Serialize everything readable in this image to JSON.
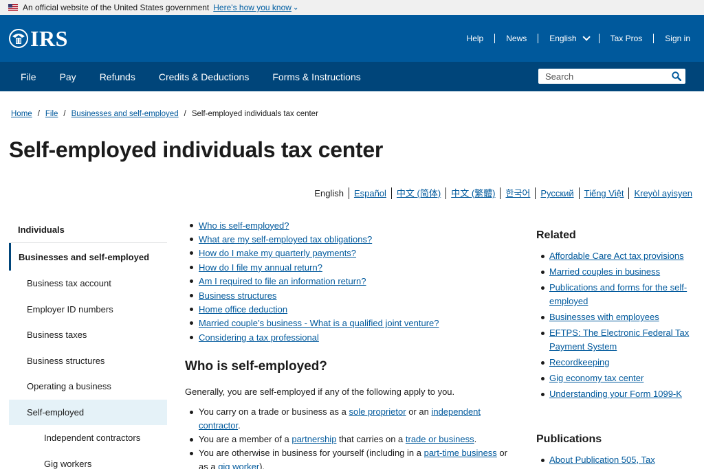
{
  "gov_banner": {
    "text": "An official website of the United States government",
    "link": "Here's how you know"
  },
  "header": {
    "logo": "IRS",
    "utility": [
      "Help",
      "News",
      "English",
      "Tax Pros",
      "Sign in"
    ]
  },
  "nav": {
    "items": [
      "File",
      "Pay",
      "Refunds",
      "Credits & Deductions",
      "Forms & Instructions"
    ],
    "search_placeholder": "Search"
  },
  "breadcrumb": [
    "Home",
    "File",
    "Businesses and self-employed",
    "Self-employed individuals tax center"
  ],
  "page_title": "Self-employed individuals tax center",
  "languages": [
    "English",
    "Español",
    "中文 (简体)",
    "中文 (繁體)",
    "한국어",
    "Русский",
    "Tiếng Việt",
    "Kreyòl ayisyen"
  ],
  "sidebar": {
    "heading": "Individuals",
    "parent": "Businesses and self-employed",
    "items": [
      "Business tax account",
      "Employer ID numbers",
      "Business taxes",
      "Business structures",
      "Operating a business",
      "Self-employed"
    ],
    "sub_items": [
      "Independent contractors",
      "Gig workers"
    ]
  },
  "content": {
    "toc": [
      "Who is self-employed?",
      "What are my self-employed tax obligations?",
      "How do I make my quarterly payments?",
      "How do I file my annual return?",
      "Am I required to file an information return?",
      "Business structures",
      "Home office deduction",
      "Married couple’s business - What is a qualified joint venture?",
      "Considering a tax professional"
    ],
    "heading": "Who is self-employed?",
    "intro": "Generally, you are self-employed if any of the following apply to you.",
    "bullets": {
      "b1_pre": "You carry on a trade or business as a ",
      "b1_link1": "sole proprietor",
      "b1_mid": " or an ",
      "b1_link2": "independent contractor",
      "b1_post": ".",
      "b2_pre": "You are a member of a ",
      "b2_link1": "partnership",
      "b2_mid": " that carries on a ",
      "b2_link2": "trade or business",
      "b2_post": ".",
      "b3_pre": "You are otherwise in business for yourself (including in a ",
      "b3_link1": "part-time business",
      "b3_mid": " or as a ",
      "b3_link2": "gig worker",
      "b3_post": ")."
    }
  },
  "related": {
    "heading": "Related",
    "links": [
      "Affordable Care Act tax provisions",
      "Married couples in business",
      "Publications and forms for the self-employed",
      "Businesses with employees",
      "EFTPS: The Electronic Federal Tax Payment System",
      "Recordkeeping",
      "Gig economy tax center",
      "Understanding your Form 1099-K"
    ]
  },
  "publications": {
    "heading": "Publications",
    "links": [
      "About Publication 505, Tax"
    ]
  },
  "colors": {
    "header_blue": "#00599c",
    "nav_blue": "#00457a",
    "link": "#00599c",
    "sidebar_selected": "#e5f2f8"
  }
}
